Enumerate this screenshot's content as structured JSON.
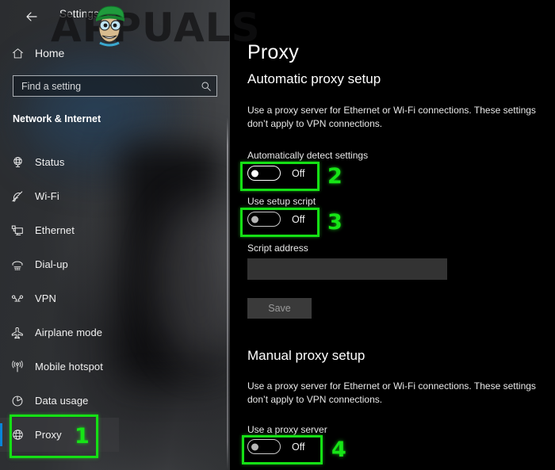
{
  "window": {
    "title": "Settings",
    "back_icon": "back-arrow-icon"
  },
  "watermark": {
    "text": "APPUALS"
  },
  "sidebar": {
    "home": {
      "label": "Home",
      "icon": "home-icon"
    },
    "search": {
      "placeholder": "Find a setting",
      "value": "Find a setting",
      "icon": "search-icon"
    },
    "group_heading": "Network & Internet",
    "items": [
      {
        "label": "Status",
        "icon": "globe-status-icon",
        "selected": false
      },
      {
        "label": "Wi-Fi",
        "icon": "wifi-icon",
        "selected": false
      },
      {
        "label": "Ethernet",
        "icon": "ethernet-icon",
        "selected": false
      },
      {
        "label": "Dial-up",
        "icon": "dialup-phone-icon",
        "selected": false
      },
      {
        "label": "VPN",
        "icon": "vpn-icon",
        "selected": false
      },
      {
        "label": "Airplane mode",
        "icon": "airplane-icon",
        "selected": false
      },
      {
        "label": "Mobile hotspot",
        "icon": "hotspot-icon",
        "selected": false
      },
      {
        "label": "Data usage",
        "icon": "pie-chart-icon",
        "selected": false
      },
      {
        "label": "Proxy",
        "icon": "globe-proxy-icon",
        "selected": true
      }
    ]
  },
  "main": {
    "page_title": "Proxy",
    "automatic": {
      "heading": "Automatic proxy setup",
      "description": "Use a proxy server for Ethernet or Wi-Fi connections. These settings don’t apply to VPN connections.",
      "auto_detect": {
        "label": "Automatically detect settings",
        "state": "Off"
      },
      "setup_script": {
        "label": "Use setup script",
        "state": "Off"
      },
      "script_address": {
        "label": "Script address",
        "value": ""
      },
      "save_label": "Save"
    },
    "manual": {
      "heading": "Manual proxy setup",
      "description": "Use a proxy server for Ethernet or Wi-Fi connections. These settings don’t apply to VPN connections.",
      "use_proxy": {
        "label": "Use a proxy server",
        "state": "Off"
      }
    }
  },
  "annotations": {
    "color": "#15e015",
    "steps": [
      {
        "number": "1",
        "target": "sidebar-item-proxy"
      },
      {
        "number": "2",
        "target": "toggle-automatically-detect-settings"
      },
      {
        "number": "3",
        "target": "toggle-use-setup-script"
      },
      {
        "number": "4",
        "target": "toggle-use-a-proxy-server"
      }
    ]
  }
}
